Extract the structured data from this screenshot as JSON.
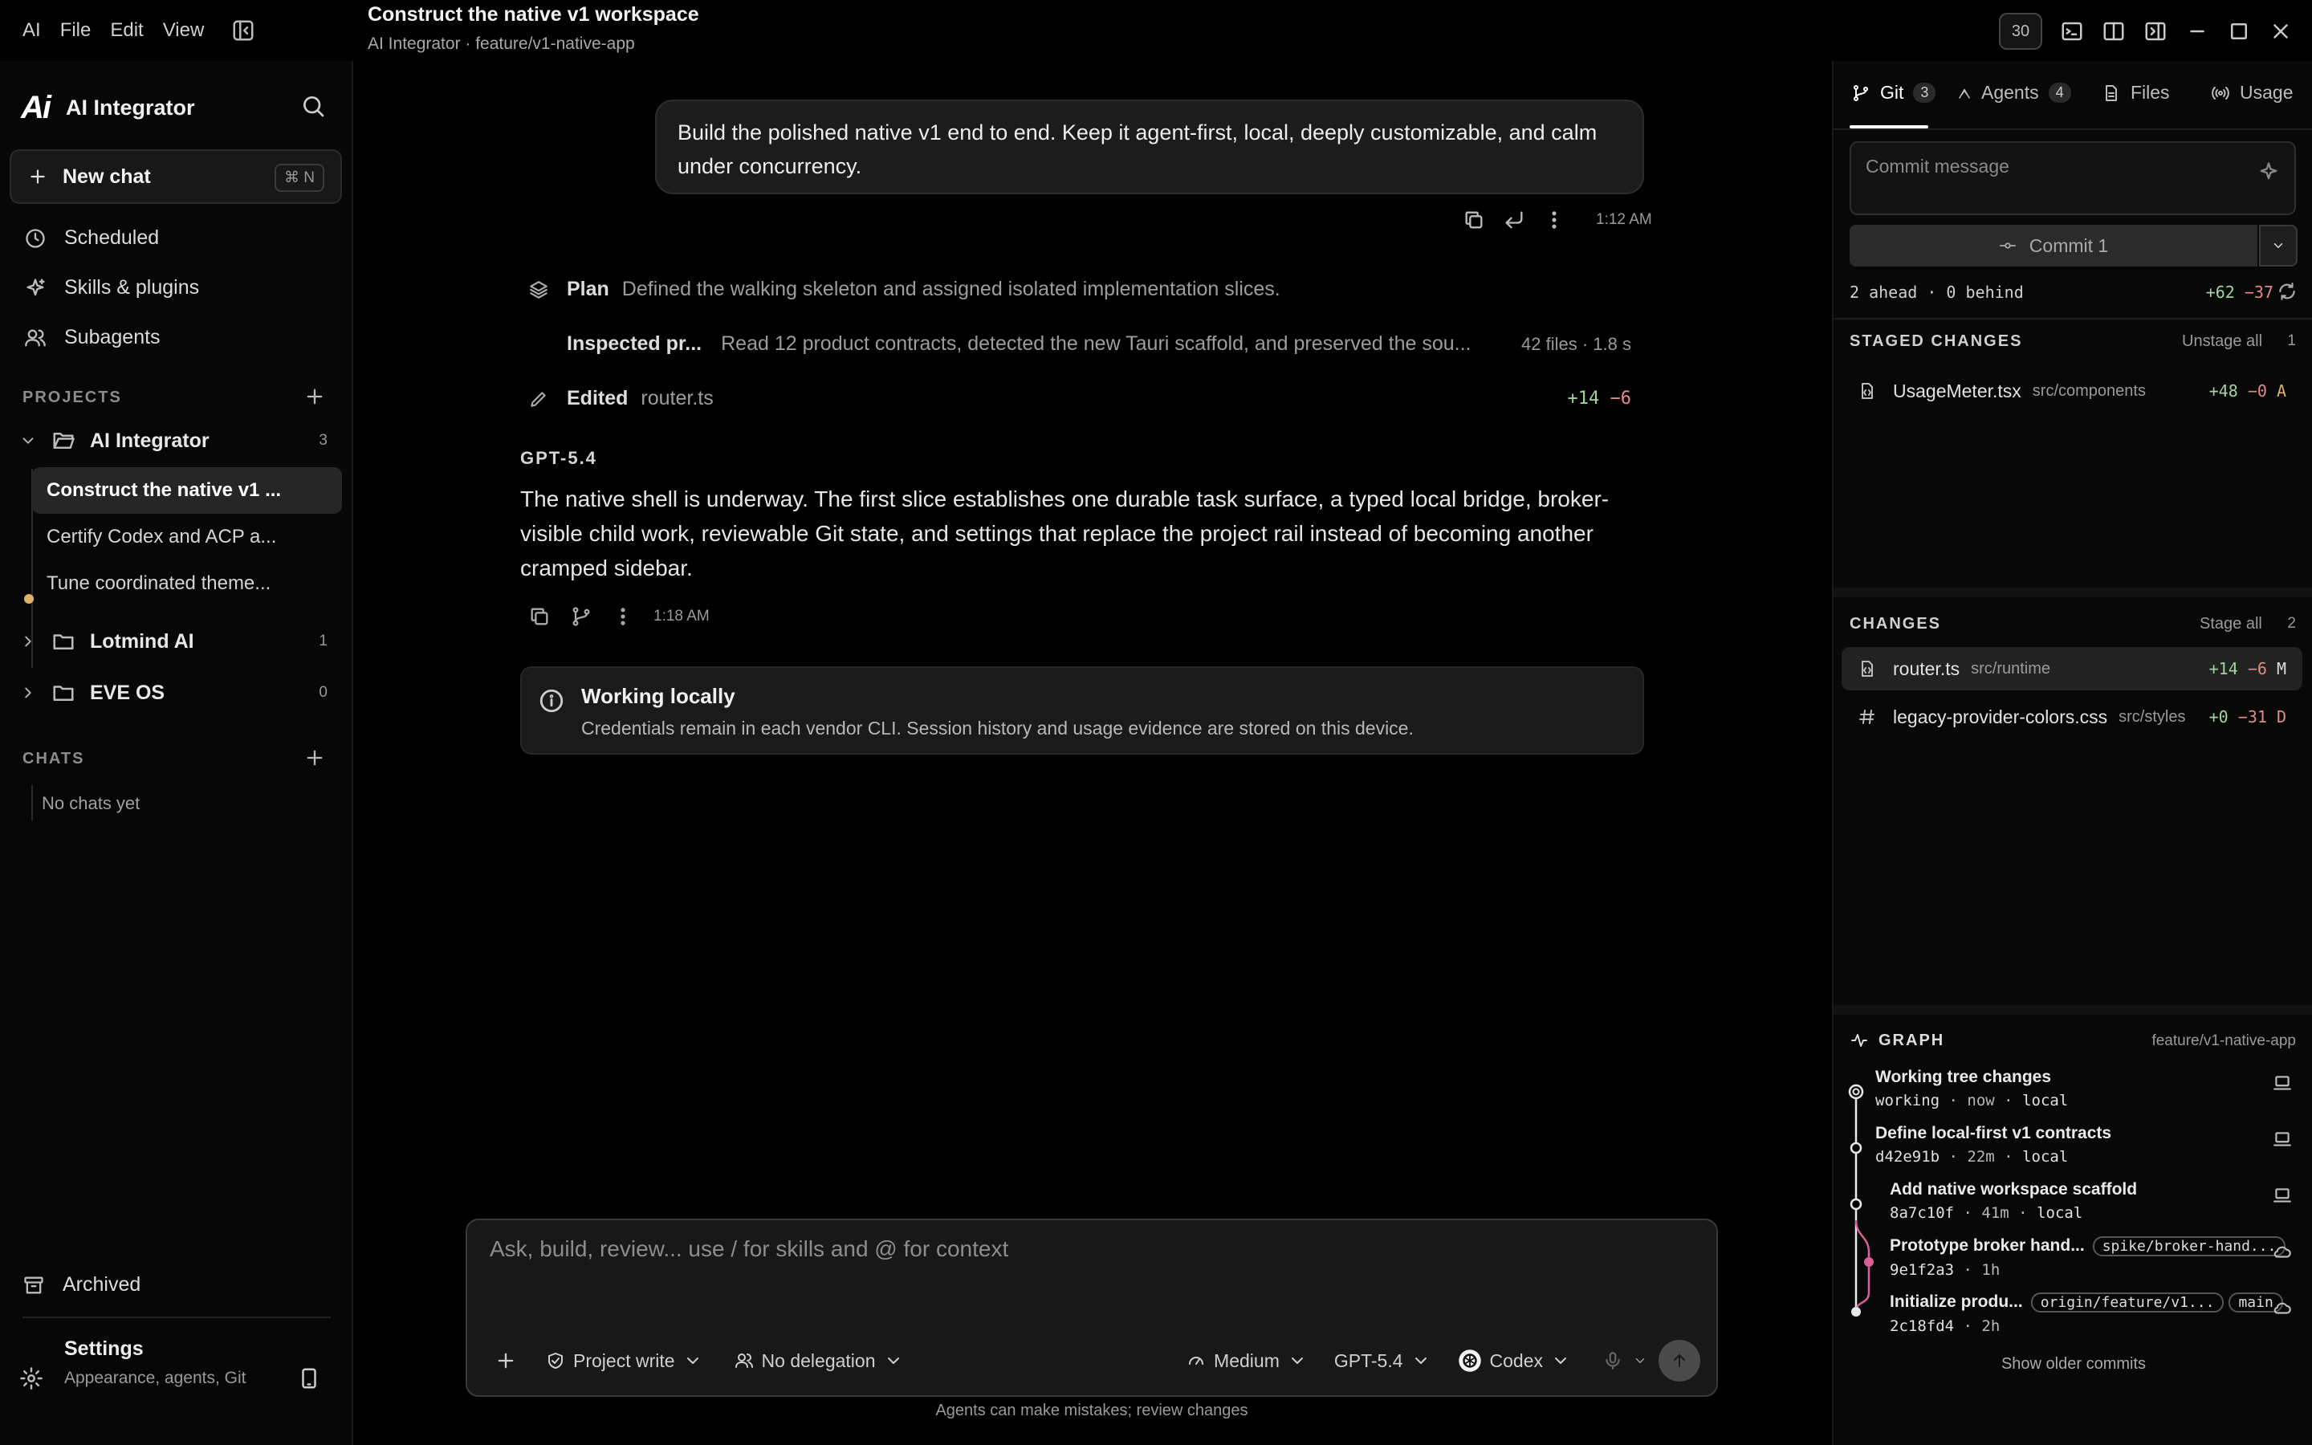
{
  "menu": {
    "logo": "AI",
    "items": [
      "File",
      "Edit",
      "View"
    ]
  },
  "thread": {
    "title": "Construct the native v1 workspace",
    "subtitle": "AI Integrator · feature/v1-native-app"
  },
  "window": {
    "badge": "30"
  },
  "sidebar": {
    "brand": {
      "logo": "Ai",
      "name": "AI Integrator"
    },
    "new_chat": {
      "label": "New chat",
      "shortcut": "⌘ N"
    },
    "nav": [
      {
        "label": "Scheduled",
        "icon": "clock-icon"
      },
      {
        "label": "Skills & plugins",
        "icon": "sparkle-icon"
      },
      {
        "label": "Subagents",
        "icon": "users-icon"
      }
    ],
    "projects_label": "PROJECTS",
    "projects": [
      {
        "name": "AI Integrator",
        "count": "3",
        "expanded": true,
        "threads": [
          "Construct the native v1 ...",
          "Certify Codex and ACP a...",
          "Tune coordinated theme..."
        ]
      },
      {
        "name": "Lotmind AI",
        "count": "1"
      },
      {
        "name": "EVE OS",
        "count": "0"
      }
    ],
    "chats_label": "CHATS",
    "no_chats": "No chats yet",
    "archived": "Archived",
    "settings": {
      "title": "Settings",
      "subtitle": "Appearance, agents, Git"
    }
  },
  "conversation": {
    "user_message": "Build the polished native v1 end to end. Keep it agent-first, local, deeply customizable, and calm under concurrency.",
    "user_time": "1:12 AM",
    "steps": [
      {
        "kind": "Plan",
        "text": "Defined the walking skeleton and assigned isolated implementation slices."
      },
      {
        "kind": "Inspected pr...",
        "text": "Read 12 product contracts, detected the new Tauri scaffold, and preserved the sou...",
        "meta": "42 files · 1.8 s"
      },
      {
        "kind": "Edited",
        "text": "router.ts",
        "add": "+14",
        "del": "−6"
      }
    ],
    "model": "GPT-5.4",
    "answer": "The native shell is underway. The first slice establishes one durable task surface, a typed local bridge, broker-visible child work, reviewable Git state, and settings that replace the project rail instead of becoming another cramped sidebar.",
    "answer_time": "1:18 AM",
    "notice": {
      "title": "Working locally",
      "body": "Credentials remain in each vendor CLI. Session history and usage evidence are stored on this device."
    }
  },
  "composer": {
    "placeholder": "Ask, build, review... use / for skills and @ for context",
    "permission": "Project write",
    "delegation": "No delegation",
    "effort": "Medium",
    "model": "GPT-5.4",
    "agent": "Codex",
    "footer": "Agents can make mistakes; review changes"
  },
  "panel": {
    "tabs": [
      {
        "label": "Git",
        "count": "3"
      },
      {
        "label": "Agents",
        "count": "4"
      },
      {
        "label": "Files"
      },
      {
        "label": "Usage"
      }
    ],
    "commit_placeholder": "Commit message",
    "commit_label": "Commit 1",
    "ahead_behind": "2 ahead · 0 behind",
    "diff_add": "+62",
    "diff_del": "−37",
    "staged": {
      "label": "STAGED CHANGES",
      "action": "Unstage all",
      "count": "1",
      "files": [
        {
          "name": "UsageMeter.tsx",
          "dir": "src/components",
          "add": "+48",
          "del": "−0",
          "status": "A"
        }
      ]
    },
    "changes": {
      "label": "CHANGES",
      "action": "Stage all",
      "count": "2",
      "files": [
        {
          "name": "router.ts",
          "dir": "src/runtime",
          "add": "+14",
          "del": "−6",
          "status": "M"
        },
        {
          "name": "legacy-provider-colors.css",
          "dir": "src/styles",
          "add": "+0",
          "del": "−31",
          "status": "D"
        }
      ]
    },
    "graph": {
      "label": "GRAPH",
      "branch": "feature/v1-native-app",
      "commits": [
        {
          "title": "Working tree changes",
          "hash": "working",
          "age": "now",
          "where": "local"
        },
        {
          "title": "Define local-first v1 contracts",
          "hash": "d42e91b",
          "age": "22m",
          "where": "local"
        },
        {
          "title": "Add native workspace scaffold",
          "hash": "8a7c10f",
          "age": "41m",
          "where": "local"
        },
        {
          "title": "Prototype broker hand...",
          "hash": "9e1f2a3",
          "age": "1h",
          "tags": [
            "spike/broker-hand..."
          ]
        },
        {
          "title": "Initialize produ...",
          "hash": "2c18fd4",
          "age": "2h",
          "tags": [
            "origin/feature/v1...",
            "main"
          ]
        }
      ],
      "show_older": "Show older commits"
    }
  },
  "colors": {
    "accent_add": "#9fd49f",
    "accent_del": "#e58a8a",
    "graph_branch": "#d6609a",
    "unread_dot": "#e0b16a"
  }
}
